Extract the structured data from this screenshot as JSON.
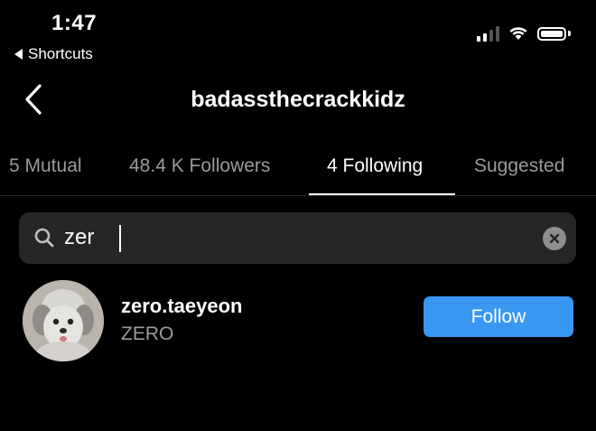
{
  "status_bar": {
    "time": "1:47",
    "back_app": "Shortcuts",
    "signal_bars_filled": 2,
    "signal_bars_total": 4,
    "battery_level": 1.0
  },
  "header": {
    "title": "badassthecrackkidz"
  },
  "tabs": [
    {
      "label": "5 Mutual",
      "active": false
    },
    {
      "label": "48.4 K Followers",
      "active": false
    },
    {
      "label": "4 Following",
      "active": true
    },
    {
      "label": "Suggested",
      "active": false
    }
  ],
  "search": {
    "value": "zer",
    "placeholder": "Search"
  },
  "results": [
    {
      "username": "zero.taeyeon",
      "full_name": "ZERO",
      "button_label": "Follow"
    }
  ],
  "colors": {
    "background": "#000000",
    "follow_button": "#3897f0",
    "search_bg": "#262626",
    "secondary_text": "#9a9a9a"
  }
}
